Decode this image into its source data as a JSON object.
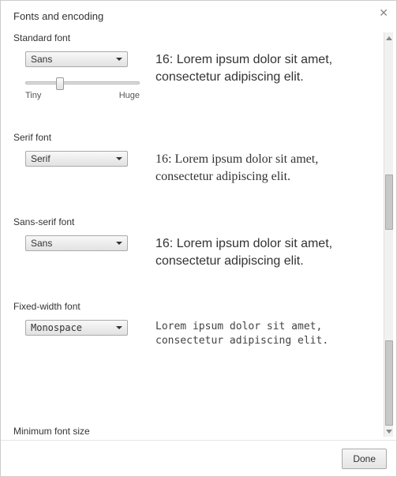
{
  "dialog": {
    "title": "Fonts and encoding",
    "done_label": "Done"
  },
  "standard": {
    "label": "Standard font",
    "selected": "Sans",
    "slider_min_label": "Tiny",
    "slider_max_label": "Huge",
    "preview": "16: Lorem ipsum dolor sit amet, consectetur adipiscing elit."
  },
  "serif": {
    "label": "Serif font",
    "selected": "Serif",
    "preview": "16: Lorem ipsum dolor sit amet, consectetur adipiscing elit."
  },
  "sans_serif": {
    "label": "Sans-serif font",
    "selected": "Sans",
    "preview": "16: Lorem ipsum dolor sit amet, consectetur adipiscing elit."
  },
  "fixed_width": {
    "label": "Fixed-width font",
    "selected": "Monospace",
    "preview": "Lorem ipsum dolor sit amet, consectetur adipiscing elit."
  },
  "minimum": {
    "label": "Minimum font size"
  }
}
